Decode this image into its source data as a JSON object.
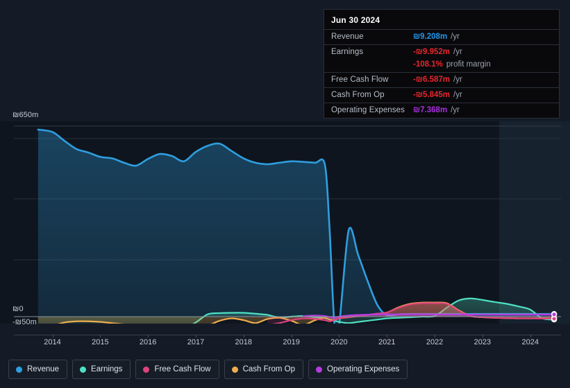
{
  "tooltip": {
    "title": "Jun 30 2024",
    "rows": [
      {
        "label": "Revenue",
        "value": "₪9.208m",
        "unit": "/yr",
        "color": "blue"
      },
      {
        "label": "Earnings",
        "value": "-₪9.952m",
        "unit": "/yr",
        "color": "red"
      },
      {
        "label": "",
        "value": "-108.1%",
        "unit": "profit margin",
        "color": "red",
        "sub": true
      },
      {
        "label": "Free Cash Flow",
        "value": "-₪6.587m",
        "unit": "/yr",
        "color": "red"
      },
      {
        "label": "Cash From Op",
        "value": "-₪5.845m",
        "unit": "/yr",
        "color": "red"
      },
      {
        "label": "Operating Expenses",
        "value": "₪7.368m",
        "unit": "/yr",
        "color": "purple"
      }
    ]
  },
  "legend": {
    "items": [
      {
        "label": "Revenue",
        "color": "#2e9fe0"
      },
      {
        "label": "Earnings",
        "color": "#4fe0c3"
      },
      {
        "label": "Free Cash Flow",
        "color": "#e0427e"
      },
      {
        "label": "Cash From Op",
        "color": "#eeae4e"
      },
      {
        "label": "Operating Expenses",
        "color": "#b43ce0"
      }
    ]
  },
  "axes": {
    "y_top_label": "₪650m",
    "y_zero_label": "₪0",
    "y_neg_label": "-₪50m",
    "x_labels": [
      "2014",
      "2015",
      "2016",
      "2017",
      "2018",
      "2019",
      "2020",
      "2021",
      "2022",
      "2023",
      "2024"
    ]
  },
  "chart_data": {
    "type": "area",
    "title": "",
    "xlabel": "",
    "ylabel": "₪ (millions)",
    "ylim": [
      -50,
      650
    ],
    "xlim": [
      2013.6,
      2024.6
    ],
    "grid": true,
    "legend_position": "bottom",
    "highlight_region": {
      "from": 2023.35,
      "to": 2024.6
    },
    "x": [
      2013.7,
      2014.0,
      2014.25,
      2014.5,
      2014.75,
      2015.0,
      2015.25,
      2015.5,
      2015.75,
      2016.0,
      2016.25,
      2016.5,
      2016.75,
      2017.0,
      2017.25,
      2017.5,
      2017.75,
      2018.0,
      2018.25,
      2018.5,
      2018.75,
      2019.0,
      2019.25,
      2019.5,
      2019.7,
      2019.8,
      2019.9,
      2020.0,
      2020.2,
      2020.4,
      2020.6,
      2020.8,
      2021.0,
      2021.25,
      2021.5,
      2021.75,
      2022.0,
      2022.25,
      2022.5,
      2022.75,
      2023.0,
      2023.25,
      2023.5,
      2023.75,
      2024.0,
      2024.25,
      2024.5
    ],
    "series": [
      {
        "name": "Revenue",
        "color": "#2e9fe0",
        "values": [
          638,
          630,
          600,
          572,
          560,
          545,
          540,
          525,
          515,
          538,
          555,
          548,
          530,
          562,
          583,
          590,
          565,
          540,
          525,
          520,
          525,
          530,
          528,
          525,
          520,
          300,
          -20,
          -30,
          295,
          210,
          120,
          40,
          5,
          8,
          9,
          9,
          9,
          9,
          9,
          9,
          9,
          9,
          9,
          9,
          9,
          9,
          9.208
        ]
      },
      {
        "name": "Earnings",
        "color": "#4fe0c3",
        "values": [
          -48,
          -47,
          -47,
          -46,
          -46,
          -46,
          -46,
          -46,
          -46,
          -46,
          -46,
          -45,
          -40,
          -20,
          8,
          12,
          13,
          13,
          10,
          6,
          -3,
          0,
          2,
          -2,
          -5,
          -10,
          -14,
          -18,
          -22,
          -18,
          -14,
          -10,
          -6,
          -4,
          -2,
          0,
          2,
          30,
          55,
          62,
          57,
          50,
          44,
          35,
          24,
          -6,
          -9.952
        ]
      },
      {
        "name": "Free Cash Flow",
        "color": "#e0427e",
        "values": [
          null,
          null,
          null,
          null,
          null,
          null,
          null,
          null,
          null,
          null,
          null,
          null,
          null,
          null,
          null,
          null,
          null,
          null,
          null,
          -28,
          -22,
          -12,
          -6,
          -8,
          -12,
          -16,
          -12,
          -6,
          -2,
          2,
          6,
          10,
          14,
          30,
          42,
          46,
          46,
          44,
          20,
          2,
          -2,
          -4,
          -5,
          -6,
          -6,
          -6.5,
          -6.587
        ]
      },
      {
        "name": "Cash From Op",
        "color": "#eeae4e",
        "values": [
          -48,
          -32,
          -20,
          -16,
          -16,
          -18,
          -22,
          -26,
          -28,
          -28,
          -28,
          -30,
          -34,
          -36,
          -30,
          -14,
          -6,
          -12,
          -22,
          -8,
          -4,
          -14,
          -28,
          -12,
          -4,
          -10,
          -12,
          -6,
          -2,
          2,
          6,
          10,
          14,
          32,
          44,
          48,
          48,
          46,
          22,
          2,
          -2,
          -4,
          -5,
          -6,
          -6,
          -5.5,
          -5.845
        ]
      },
      {
        "name": "Operating Expenses",
        "color": "#b43ce0",
        "values": [
          null,
          null,
          null,
          null,
          null,
          null,
          null,
          null,
          null,
          null,
          null,
          null,
          null,
          null,
          null,
          null,
          null,
          null,
          null,
          null,
          null,
          null,
          2,
          4,
          2,
          -2,
          -4,
          0,
          4,
          6,
          7,
          8,
          8,
          8,
          8,
          8,
          7.5,
          7.4,
          7.4,
          7.4,
          7.4,
          7.4,
          7.4,
          7.4,
          7.4,
          7.4,
          7.368
        ]
      }
    ]
  }
}
